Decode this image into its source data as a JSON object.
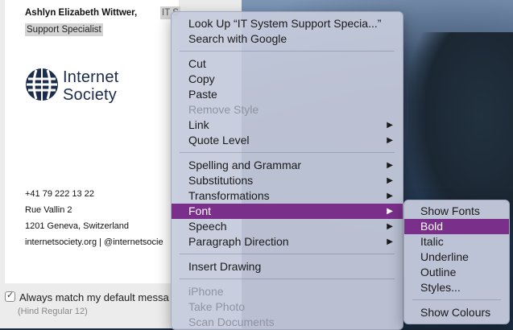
{
  "signature": {
    "name": "Ashlyn Elizabeth Wittwer,",
    "title_part1": "IT S",
    "title_part2": "Support Specialist",
    "logo_text_line1": "Internet",
    "logo_text_line2": "Society",
    "phone": "+41 79 222 13 22",
    "address_line1": "Rue Vallin 2",
    "address_line2": "1201 Geneva, Switzerland",
    "web": "internetsociety.org | @internetsocie"
  },
  "options": {
    "match_font_label": "Always match my default messa",
    "match_font_checked": true,
    "checkmark": "✓",
    "font_hint": "(Hind Regular 12)"
  },
  "context_menu": {
    "look_up": "Look Up “IT System Support Specia...”",
    "search_google": "Search with Google",
    "cut": "Cut",
    "copy": "Copy",
    "paste": "Paste",
    "remove_style": "Remove Style",
    "link": "Link",
    "quote_level": "Quote Level",
    "spelling": "Spelling and Grammar",
    "substitutions": "Substitutions",
    "transformations": "Transformations",
    "font": "Font",
    "speech": "Speech",
    "paragraph_direction": "Paragraph Direction",
    "insert_drawing": "Insert Drawing",
    "iphone": "iPhone",
    "take_photo": "Take Photo",
    "scan_documents": "Scan Documents",
    "submenu_arrow": "▶"
  },
  "font_submenu": {
    "show_fonts": "Show Fonts",
    "bold": "Bold",
    "italic": "Italic",
    "underline": "Underline",
    "outline": "Outline",
    "styles": "Styles...",
    "show_colours": "Show Colours"
  },
  "colors": {
    "highlight": "#7a2f8a",
    "menu_bg": "#c6cbdd"
  }
}
